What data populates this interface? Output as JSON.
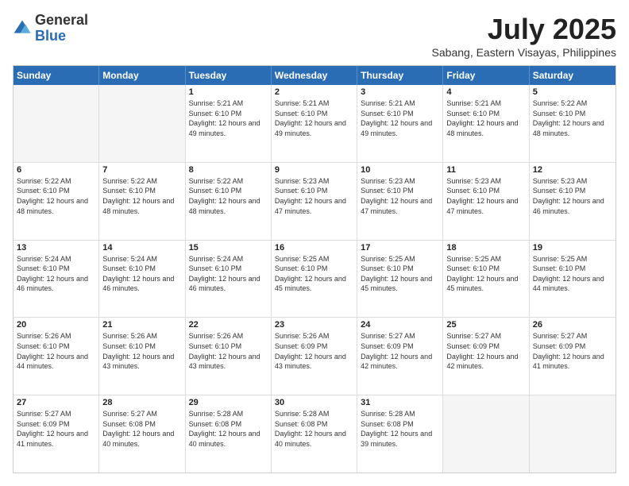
{
  "logo": {
    "general": "General",
    "blue": "Blue"
  },
  "title": "July 2025",
  "subtitle": "Sabang, Eastern Visayas, Philippines",
  "header_days": [
    "Sunday",
    "Monday",
    "Tuesday",
    "Wednesday",
    "Thursday",
    "Friday",
    "Saturday"
  ],
  "weeks": [
    [
      {
        "day": "",
        "info": ""
      },
      {
        "day": "",
        "info": ""
      },
      {
        "day": "1",
        "info": "Sunrise: 5:21 AM\nSunset: 6:10 PM\nDaylight: 12 hours and 49 minutes."
      },
      {
        "day": "2",
        "info": "Sunrise: 5:21 AM\nSunset: 6:10 PM\nDaylight: 12 hours and 49 minutes."
      },
      {
        "day": "3",
        "info": "Sunrise: 5:21 AM\nSunset: 6:10 PM\nDaylight: 12 hours and 49 minutes."
      },
      {
        "day": "4",
        "info": "Sunrise: 5:21 AM\nSunset: 6:10 PM\nDaylight: 12 hours and 48 minutes."
      },
      {
        "day": "5",
        "info": "Sunrise: 5:22 AM\nSunset: 6:10 PM\nDaylight: 12 hours and 48 minutes."
      }
    ],
    [
      {
        "day": "6",
        "info": "Sunrise: 5:22 AM\nSunset: 6:10 PM\nDaylight: 12 hours and 48 minutes."
      },
      {
        "day": "7",
        "info": "Sunrise: 5:22 AM\nSunset: 6:10 PM\nDaylight: 12 hours and 48 minutes."
      },
      {
        "day": "8",
        "info": "Sunrise: 5:22 AM\nSunset: 6:10 PM\nDaylight: 12 hours and 48 minutes."
      },
      {
        "day": "9",
        "info": "Sunrise: 5:23 AM\nSunset: 6:10 PM\nDaylight: 12 hours and 47 minutes."
      },
      {
        "day": "10",
        "info": "Sunrise: 5:23 AM\nSunset: 6:10 PM\nDaylight: 12 hours and 47 minutes."
      },
      {
        "day": "11",
        "info": "Sunrise: 5:23 AM\nSunset: 6:10 PM\nDaylight: 12 hours and 47 minutes."
      },
      {
        "day": "12",
        "info": "Sunrise: 5:23 AM\nSunset: 6:10 PM\nDaylight: 12 hours and 46 minutes."
      }
    ],
    [
      {
        "day": "13",
        "info": "Sunrise: 5:24 AM\nSunset: 6:10 PM\nDaylight: 12 hours and 46 minutes."
      },
      {
        "day": "14",
        "info": "Sunrise: 5:24 AM\nSunset: 6:10 PM\nDaylight: 12 hours and 46 minutes."
      },
      {
        "day": "15",
        "info": "Sunrise: 5:24 AM\nSunset: 6:10 PM\nDaylight: 12 hours and 46 minutes."
      },
      {
        "day": "16",
        "info": "Sunrise: 5:25 AM\nSunset: 6:10 PM\nDaylight: 12 hours and 45 minutes."
      },
      {
        "day": "17",
        "info": "Sunrise: 5:25 AM\nSunset: 6:10 PM\nDaylight: 12 hours and 45 minutes."
      },
      {
        "day": "18",
        "info": "Sunrise: 5:25 AM\nSunset: 6:10 PM\nDaylight: 12 hours and 45 minutes."
      },
      {
        "day": "19",
        "info": "Sunrise: 5:25 AM\nSunset: 6:10 PM\nDaylight: 12 hours and 44 minutes."
      }
    ],
    [
      {
        "day": "20",
        "info": "Sunrise: 5:26 AM\nSunset: 6:10 PM\nDaylight: 12 hours and 44 minutes."
      },
      {
        "day": "21",
        "info": "Sunrise: 5:26 AM\nSunset: 6:10 PM\nDaylight: 12 hours and 43 minutes."
      },
      {
        "day": "22",
        "info": "Sunrise: 5:26 AM\nSunset: 6:10 PM\nDaylight: 12 hours and 43 minutes."
      },
      {
        "day": "23",
        "info": "Sunrise: 5:26 AM\nSunset: 6:09 PM\nDaylight: 12 hours and 43 minutes."
      },
      {
        "day": "24",
        "info": "Sunrise: 5:27 AM\nSunset: 6:09 PM\nDaylight: 12 hours and 42 minutes."
      },
      {
        "day": "25",
        "info": "Sunrise: 5:27 AM\nSunset: 6:09 PM\nDaylight: 12 hours and 42 minutes."
      },
      {
        "day": "26",
        "info": "Sunrise: 5:27 AM\nSunset: 6:09 PM\nDaylight: 12 hours and 41 minutes."
      }
    ],
    [
      {
        "day": "27",
        "info": "Sunrise: 5:27 AM\nSunset: 6:09 PM\nDaylight: 12 hours and 41 minutes."
      },
      {
        "day": "28",
        "info": "Sunrise: 5:27 AM\nSunset: 6:08 PM\nDaylight: 12 hours and 40 minutes."
      },
      {
        "day": "29",
        "info": "Sunrise: 5:28 AM\nSunset: 6:08 PM\nDaylight: 12 hours and 40 minutes."
      },
      {
        "day": "30",
        "info": "Sunrise: 5:28 AM\nSunset: 6:08 PM\nDaylight: 12 hours and 40 minutes."
      },
      {
        "day": "31",
        "info": "Sunrise: 5:28 AM\nSunset: 6:08 PM\nDaylight: 12 hours and 39 minutes."
      },
      {
        "day": "",
        "info": ""
      },
      {
        "day": "",
        "info": ""
      }
    ]
  ]
}
